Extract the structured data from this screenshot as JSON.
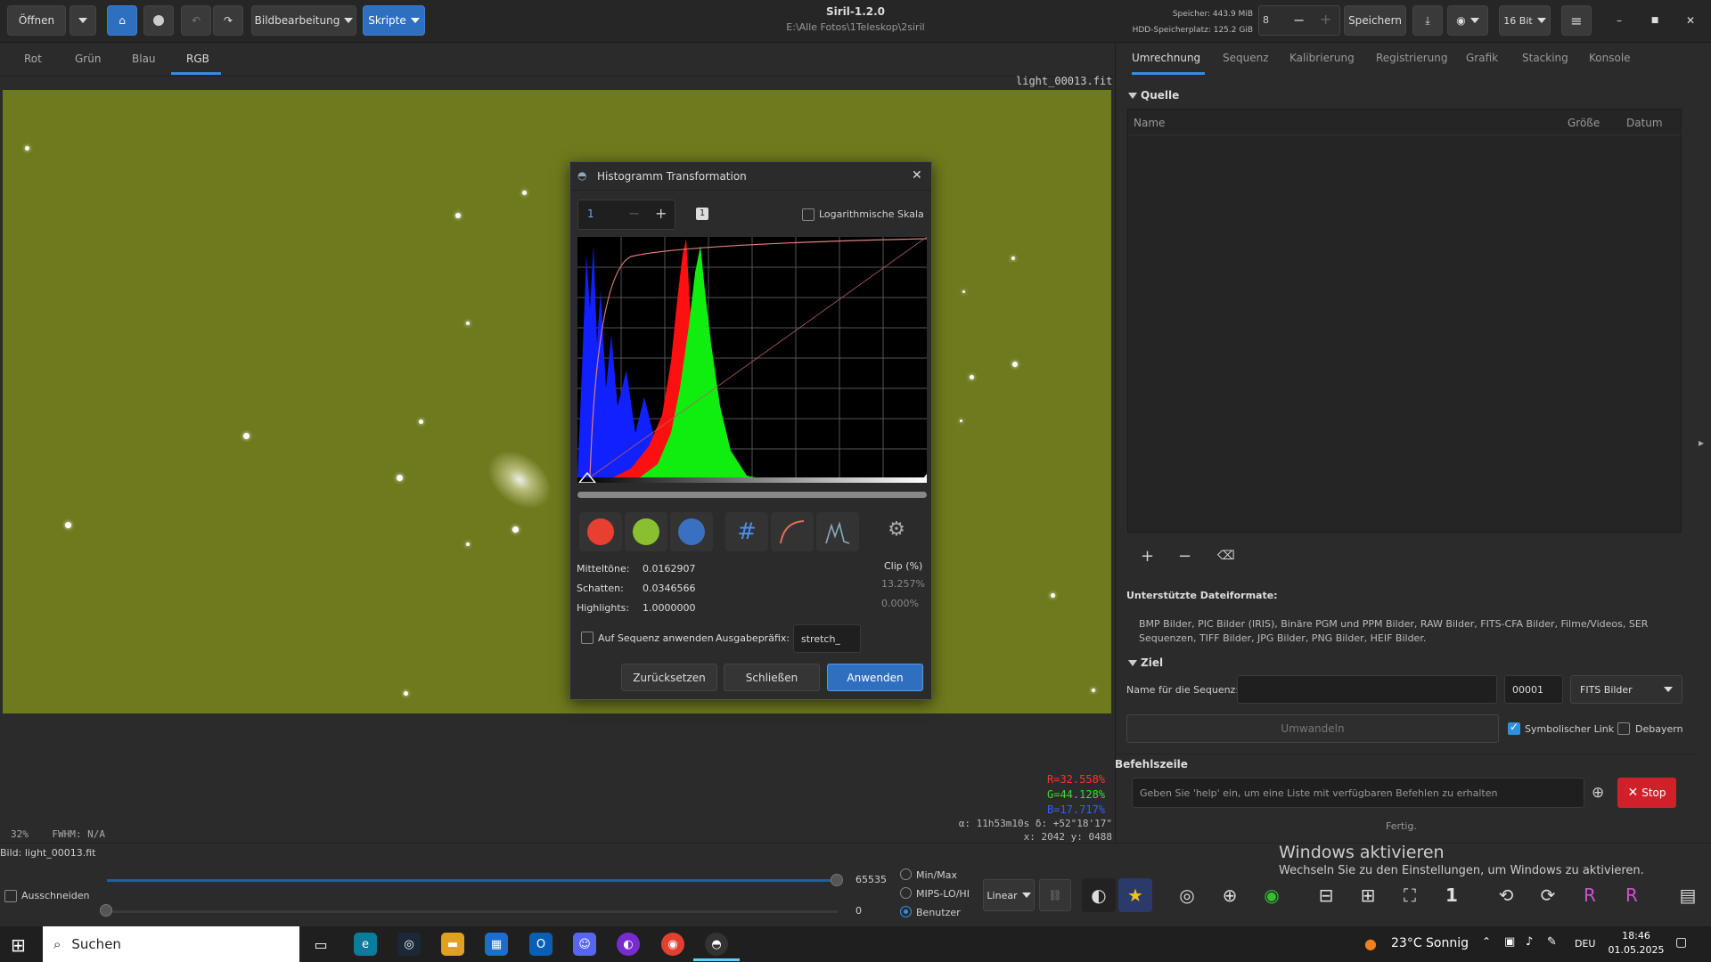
{
  "titlebar": {
    "open_label": "Öffnen",
    "image_processing_label": "Bildbearbeitung",
    "scripts_label": "Skripte",
    "app_title": "Siril-1.2.0",
    "app_path": "E:\\Alle Fotos\\1Teleskop\\2siril",
    "memory_label": "Speicher: 443.9 MiB",
    "disk_label": "HDD-Speicherplatz: 125.2 GiB",
    "threads_value": "8",
    "save_label": "Speichern",
    "bitdepth_label": "16 Bit"
  },
  "channel_tabs": [
    "Rot",
    "Grün",
    "Blau",
    "RGB"
  ],
  "active_channel_tab": "RGB",
  "image_view": {
    "filename_overlay": "light_00013.fit",
    "r_value": "R=32.558%",
    "g_value": "G=44.128%",
    "b_value": "B=17.717%",
    "coord_line1": "α: 11h53m10s δ: +52°18'17\"",
    "coord_line2": "x: 2042 y: 0488",
    "zoom": "32%",
    "fwhm": "FWHM: N/A",
    "image_label": "Bild: light_00013.fit"
  },
  "bottom": {
    "crop_label": "Ausschneiden",
    "max_value": "65535",
    "min_value": "0",
    "radio_minmax": "Min/Max",
    "radio_mips": "MIPS-LO/HI",
    "radio_user": "Benutzer",
    "scale_mode": "Linear"
  },
  "right_panel": {
    "tabs": [
      "Umrechnung",
      "Sequenz",
      "Kalibrierung",
      "Registrierung",
      "Grafik",
      "Stacking",
      "Konsole"
    ],
    "source_section": "Quelle",
    "col_name": "Name",
    "col_size": "Größe",
    "col_date": "Datum",
    "supported_title": "Unterstützte Dateiformate:",
    "supported_text": "BMP Bilder, PIC Bilder (IRIS), Binäre PGM und PPM Bilder, RAW Bilder, FITS-CFA Bilder, Filme/Videos, SER Sequenzen, TIFF Bilder, JPG Bilder, PNG Bilder, HEIF Bilder.",
    "target_section": "Ziel",
    "seq_name_label": "Name für die Sequenz:",
    "seq_index": "00001",
    "format_select": "FITS Bilder",
    "convert_label": "Umwandeln",
    "symlink_label": "Symbolischer Link",
    "debayer_label": "Debayern",
    "cmdline_label": "Befehlszeile",
    "cmd_placeholder": "Geben Sie 'help' ein, um eine Liste mit verfügbaren Befehlen zu erhalten",
    "stop_label": "Stop",
    "status": "Fertig."
  },
  "dialog": {
    "title": "Histogramm Transformation",
    "zoom_value": "1",
    "log_scale_label": "Logarithmische Skala",
    "midtones_label": "Mitteltöne:",
    "midtones_value": "0.0162907",
    "shadows_label": "Schatten:",
    "shadows_value": "0.0346566",
    "highlights_label": "Highlights:",
    "highlights_value": "1.0000000",
    "clip_label": "Clip (%)",
    "clip_low": "13.257%",
    "clip_high": "0.000%",
    "apply_seq_label": "Auf Sequenz anwenden",
    "prefix_label": "Ausgabepräfix:",
    "prefix_value": "stretch_",
    "reset_label": "Zurücksetzen",
    "close_label": "Schließen",
    "apply_label": "Anwenden"
  },
  "windows_activation": {
    "title": "Windows aktivieren",
    "subtitle": "Wechseln Sie zu den Einstellungen, um Windows zu aktivieren."
  },
  "taskbar": {
    "search_placeholder": "Suchen",
    "weather": "23°C  Sonnig",
    "language": "DEU",
    "time": "18:46",
    "date": "01.05.2025"
  },
  "colors": {
    "accent": "#2f8fe0",
    "stop": "#d0202a",
    "image_bg": "#6f7a1e"
  }
}
